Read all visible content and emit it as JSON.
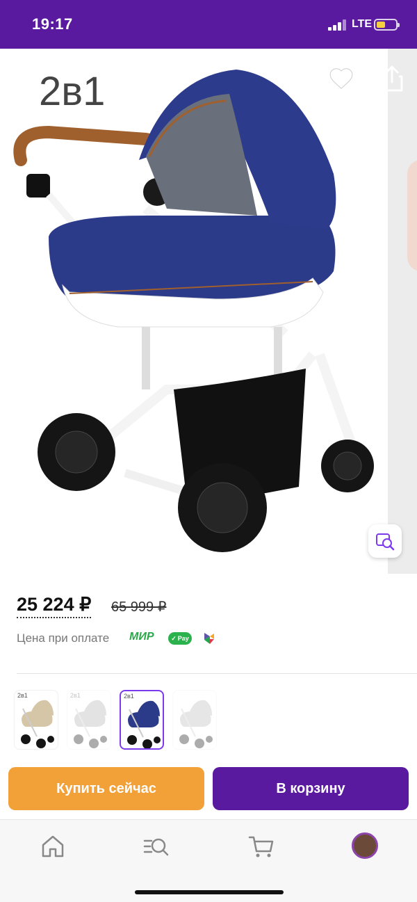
{
  "status_bar": {
    "time": "19:17",
    "network": "LTE",
    "battery_level": 0.45,
    "battery_color": "#f4d03f",
    "background": "#5a1aa0"
  },
  "product": {
    "image_label": "2в1",
    "colors": {
      "canopy": "#2c3a8a",
      "frame": "#ffffff",
      "handle": "#a0602e",
      "wheels": "#151515"
    }
  },
  "price": {
    "current": "25 224 ₽",
    "old": "65 999 ₽",
    "note": "Цена при оплате",
    "payment_methods": [
      "МИР",
      "Pay"
    ]
  },
  "variants": [
    {
      "tag": "2в1",
      "color": "#d6c6a8",
      "selected": false,
      "dim": false
    },
    {
      "tag": "2в1",
      "color": "#b0b0b0",
      "selected": false,
      "dim": true
    },
    {
      "tag": "2в1",
      "color": "#2c3a8a",
      "selected": true,
      "dim": false
    },
    {
      "tag": "",
      "color": "#b8b8b8",
      "selected": false,
      "dim": true
    }
  ],
  "actions": {
    "buy_now": "Купить сейчас",
    "add_to_cart": "В корзину",
    "buy_color": "#f2a139",
    "cart_color": "#5a1aa0"
  },
  "bottom_nav": [
    {
      "icon": "home-icon"
    },
    {
      "icon": "catalog-search-icon"
    },
    {
      "icon": "cart-icon"
    },
    {
      "icon": "profile-avatar"
    }
  ]
}
